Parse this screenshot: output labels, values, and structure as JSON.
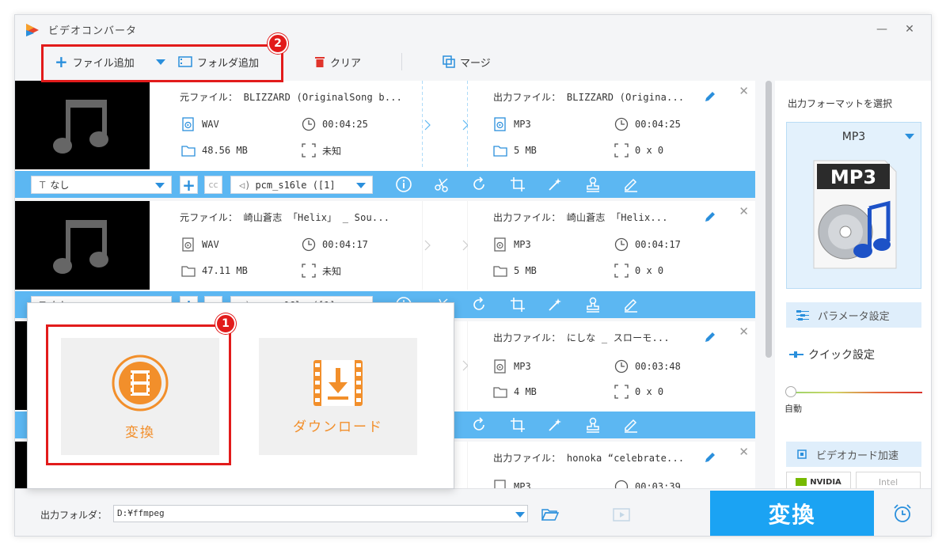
{
  "app": {
    "title": "ビデオコンバータ"
  },
  "toolbar": {
    "add_file": "ファイル追加",
    "add_folder": "フォルダ追加",
    "clear": "クリア",
    "merge": "マージ"
  },
  "items": [
    {
      "src_title": "元ファイル： BLIZZARD (OriginalSong b...",
      "src_format": "WAV",
      "src_duration": "00:04:25",
      "src_size": "48.56 MB",
      "src_resolution": "未知",
      "out_title": "出力ファイル： BLIZZARD (Origina...",
      "out_format": "MP3",
      "out_duration": "00:04:25",
      "out_size": "5 MB",
      "out_resolution": "0 x 0",
      "subtitle": "なし",
      "audio_track": "pcm_s16le ([1]"
    },
    {
      "src_title": "元ファイル： 崎山蒼志 「Helix」 _ Sou...",
      "src_format": "WAV",
      "src_duration": "00:04:17",
      "src_size": "47.11 MB",
      "src_resolution": "未知",
      "out_title": "出力ファイル： 崎山蒼志 「Helix...",
      "out_format": "MP3",
      "out_duration": "00:04:17",
      "out_size": "5 MB",
      "out_resolution": "0 x 0",
      "subtitle": "なし",
      "audio_track": "pcm_s16le ([1]"
    },
    {
      "out_title": "出力ファイル： にしな _ スローモ...",
      "out_format": "MP3",
      "out_duration": "00:03:48",
      "out_size": "4 MB",
      "out_resolution": "0 x 0"
    },
    {
      "out_title": "出力ファイル： honoka “celebrate...",
      "out_format": "MP3",
      "out_duration": "00:03:39"
    }
  ],
  "right_panel": {
    "title": "出力フォーマットを選択",
    "format": "MP3",
    "format_icon_text": "MP3",
    "param_settings": "パラメータ設定",
    "quick_settings": "クイック設定",
    "slider_label": "自動",
    "gpu_accel": "ビデオカード加速",
    "nvidia": "NVIDIA",
    "intel": "Intel"
  },
  "bottom": {
    "output_folder_label": "出力フォルダ：",
    "output_folder_value": "D:¥ffmpeg",
    "convert_button": "変換"
  },
  "popup": {
    "convert": "変換",
    "download": "ダウンロード"
  },
  "annotations": {
    "badge1": "1",
    "badge2": "2"
  },
  "colors": {
    "accent": "#1ba3f3",
    "bar": "#5cb7f2",
    "highlight": "#e21b1b",
    "orange": "#f28f2b"
  }
}
